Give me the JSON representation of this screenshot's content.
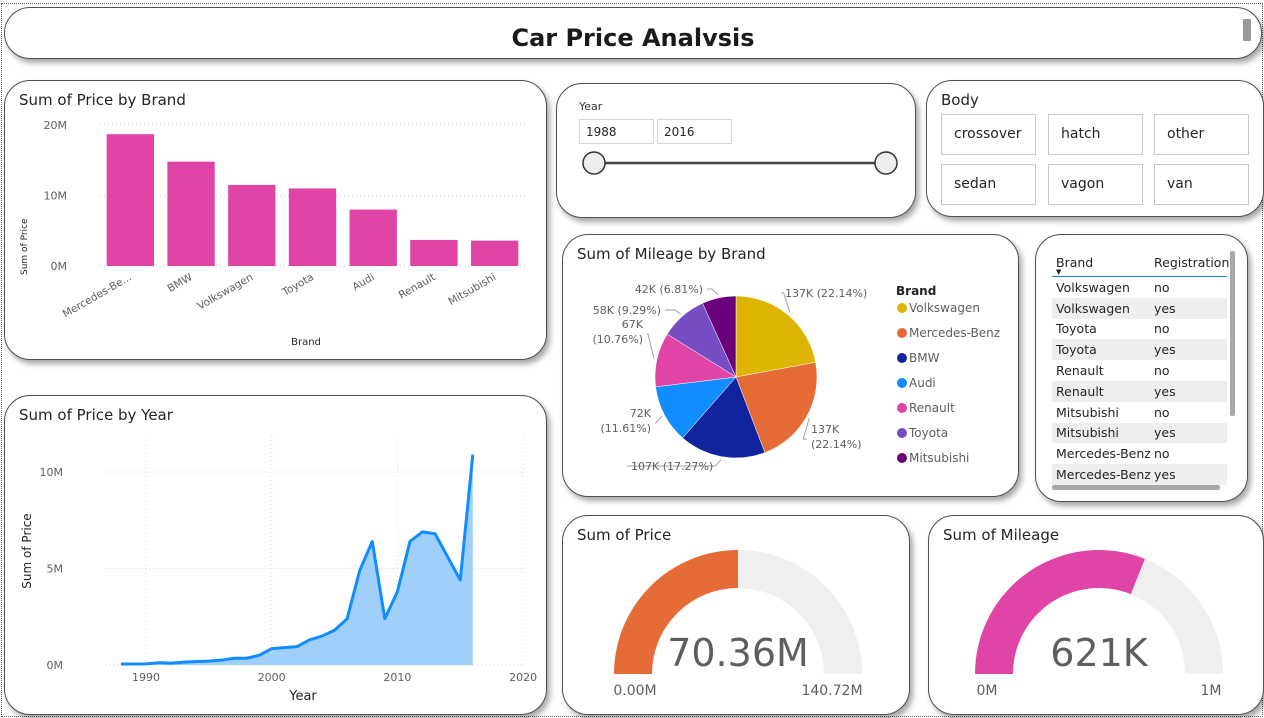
{
  "dashboard": {
    "title": "Car Price Analvsis"
  },
  "year_slicer": {
    "label": "Year",
    "start": "1988",
    "end": "2016"
  },
  "body_slicer": {
    "title": "Body",
    "options": [
      "crossover",
      "hatch",
      "other",
      "sedan",
      "vagon",
      "van"
    ]
  },
  "brand_table": {
    "columns": [
      "Brand",
      "Registration"
    ],
    "rows": [
      [
        "Volkswagen",
        "no"
      ],
      [
        "Volkswagen",
        "yes"
      ],
      [
        "Toyota",
        "no"
      ],
      [
        "Toyota",
        "yes"
      ],
      [
        "Renault",
        "no"
      ],
      [
        "Renault",
        "yes"
      ],
      [
        "Mitsubishi",
        "no"
      ],
      [
        "Mitsubishi",
        "yes"
      ],
      [
        "Mercedes-Benz",
        "no"
      ],
      [
        "Mercedes-Benz",
        "yes"
      ]
    ]
  },
  "chart_data": [
    {
      "id": "price_by_brand",
      "type": "bar",
      "title": "Sum of Price by Brand",
      "xlabel": "Brand",
      "ylabel": "Sum of Price",
      "categories": [
        "Mercedes-Be...",
        "BMW",
        "Volkswagen",
        "Toyota",
        "Audi",
        "Renault",
        "Mitsubishi"
      ],
      "values": [
        18700000,
        14800000,
        11500000,
        11000000,
        8000000,
        3700000,
        3600000
      ],
      "ylim": [
        0,
        20000000
      ],
      "yticks": [
        {
          "v": 0,
          "label": "0M"
        },
        {
          "v": 10000000,
          "label": "10M"
        },
        {
          "v": 20000000,
          "label": "20M"
        }
      ],
      "color": "#E044A7",
      "grid": true
    },
    {
      "id": "price_by_year",
      "type": "area",
      "title": "Sum of Price by Year",
      "xlabel": "Year",
      "ylabel": "Sum of Price",
      "x": [
        1988,
        1989,
        1990,
        1991,
        1992,
        1993,
        1994,
        1995,
        1996,
        1997,
        1998,
        1999,
        2000,
        2001,
        2002,
        2003,
        2004,
        2005,
        2006,
        2007,
        2008,
        2009,
        2010,
        2011,
        2012,
        2013,
        2014,
        2015,
        2016
      ],
      "values": [
        50000,
        50000,
        60000,
        120000,
        100000,
        150000,
        180000,
        200000,
        250000,
        350000,
        350000,
        500000,
        850000,
        900000,
        950000,
        1300000,
        1500000,
        1800000,
        2400000,
        4900000,
        6400000,
        2400000,
        3800000,
        6400000,
        6900000,
        6800000,
        5600000,
        4400000,
        10900000
      ],
      "xlim": [
        1985,
        2020
      ],
      "ylim": [
        0,
        12000000
      ],
      "xticks": [
        1990,
        2000,
        2010,
        2020
      ],
      "yticks": [
        {
          "v": 0,
          "label": "0M"
        },
        {
          "v": 5000000,
          "label": "5M"
        },
        {
          "v": 10000000,
          "label": "10M"
        }
      ],
      "line_color": "#118DFF",
      "fill_color": "#A0CFFA",
      "grid": true
    },
    {
      "id": "mileage_by_brand",
      "type": "pie",
      "title": "Sum of Mileage by Brand",
      "legend_title": "Brand",
      "slices": [
        {
          "name": "Volkswagen",
          "value": 137,
          "label": "137K (22.14%)",
          "color": "#DDB400"
        },
        {
          "name": "Mercedes-Benz",
          "value": 137,
          "label": "137K (22.14%)",
          "color": "#E66C37"
        },
        {
          "name": "BMW",
          "value": 107,
          "label": "107K (17.27%)",
          "color": "#12239E"
        },
        {
          "name": "Audi",
          "value": 72,
          "label": "72K (11.61%)",
          "color": "#118DFF"
        },
        {
          "name": "Renault",
          "value": 67,
          "label": "67K (10.76%)",
          "color": "#E044A7"
        },
        {
          "name": "Toyota",
          "value": 58,
          "label": "58K (9.29%)",
          "color": "#744EC2"
        },
        {
          "name": "Mitsubishi",
          "value": 42,
          "label": "42K (6.81%)",
          "color": "#6B007B"
        }
      ],
      "legend_position": "right"
    },
    {
      "id": "sum_of_price_gauge",
      "type": "gauge",
      "title": "Sum of Price",
      "value": 70.36,
      "max": 140.72,
      "value_label": "70.36M",
      "min_label": "0.00M",
      "max_label": "140.72M",
      "fill_color": "#E66C37",
      "track_color": "#F0EFEE"
    },
    {
      "id": "sum_of_mileage_gauge",
      "type": "gauge",
      "title": "Sum of Mileage",
      "value": 621,
      "max": 1000,
      "value_label": "621K",
      "min_label": "0M",
      "max_label": "1M",
      "fill_color": "#E044A7",
      "track_color": "#F0EFEE"
    }
  ]
}
